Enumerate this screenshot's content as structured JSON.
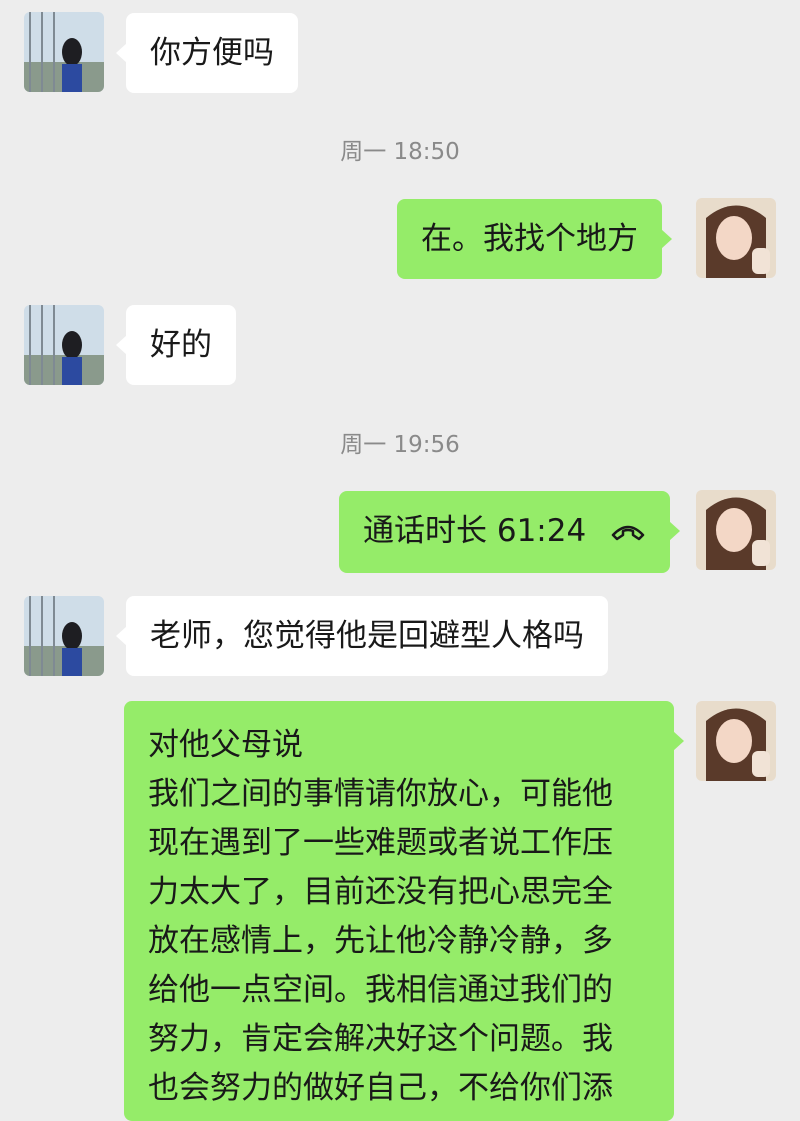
{
  "messages": [
    {
      "type": "in",
      "text": "你方便吗"
    },
    {
      "type": "time",
      "text": "周一 18:50"
    },
    {
      "type": "out",
      "text": "在。我找个地方"
    },
    {
      "type": "in",
      "text": "好的"
    },
    {
      "type": "time",
      "text": "周一 19:56"
    },
    {
      "type": "out_call",
      "text": "通话时长 61:24",
      "icon": "phone-hangup-icon"
    },
    {
      "type": "in",
      "text": "老师，您觉得他是回避型人格吗"
    },
    {
      "type": "out_long",
      "lines": [
        "对他父母说",
        "我们之间的事情请你放心，可能他",
        "现在遇到了一些难题或者说工作压",
        "力太大了，目前还没有把心思完全",
        "放在感情上，先让他冷静冷静，多",
        "给他一点空间。我相信通过我们的",
        "努力，肯定会解决好这个问题。我",
        "也会努力的做好自己，不给你们添"
      ]
    }
  ],
  "colors": {
    "background": "#ededed",
    "incoming": "#ffffff",
    "outgoing": "#95ec69"
  }
}
